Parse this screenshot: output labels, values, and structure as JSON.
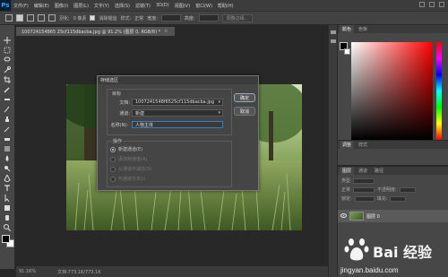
{
  "app": {
    "logo": "Ps"
  },
  "menu": [
    "文件(F)",
    "编辑(E)",
    "图像(I)",
    "图层(L)",
    "文字(Y)",
    "选择(S)",
    "滤镜(T)",
    "3D(D)",
    "视图(V)",
    "窗口(W)",
    "帮助(H)"
  ],
  "options_bar": {
    "feather_label": "羽化:",
    "feather_value": "0 像素",
    "antialias_label": "消除锯齿",
    "style_label": "样式:",
    "style_value": "正常",
    "width_label": "宽度:",
    "height_label": "高度:",
    "refine_edge": "调整边缘..."
  },
  "document": {
    "tab_title": "100724154865 25cf115dbacba.jpg @ 91.2% (图层 0, RGB/8) *",
    "tab_close": "×",
    "zoom": "91.16%",
    "doc_info": "文档:773.1K/773.1K"
  },
  "dialog": {
    "title": "存储选区",
    "section_target": "目标",
    "doc_label": "文档:",
    "doc_value": "1007241548f6525cf115dbacba.jpg",
    "channel_label": "通道:",
    "channel_value": "新建",
    "name_label": "名称(N):",
    "name_value": "人物主体",
    "section_operation": "操作",
    "ok": "确定",
    "cancel": "取消",
    "operations": [
      {
        "label": "新建通道(E)",
        "selected": true,
        "enabled": true
      },
      {
        "label": "添加到通道(A)",
        "selected": false,
        "enabled": false
      },
      {
        "label": "从通道中减去(S)",
        "selected": false,
        "enabled": false
      },
      {
        "label": "与通道交叉(I)",
        "selected": false,
        "enabled": false
      }
    ]
  },
  "panels": {
    "color_tabs": [
      "颜色",
      "色板"
    ],
    "adjust_tabs": [
      "调整",
      "样式"
    ],
    "layer_tabs": [
      "图层",
      "通道",
      "路径"
    ],
    "layer_kind": "类型",
    "blend_mode": "正常",
    "opacity_label": "不透明度:",
    "lock_label": "锁定:",
    "fill_label": "填充:",
    "layer_name": "图层 0"
  },
  "watermark": {
    "text": "Bai 经验",
    "url": "jingyan.baidu.com"
  },
  "colors": {
    "foreground": "#000000",
    "background": "#ffffff",
    "ps_blue": "#31a8ff"
  }
}
